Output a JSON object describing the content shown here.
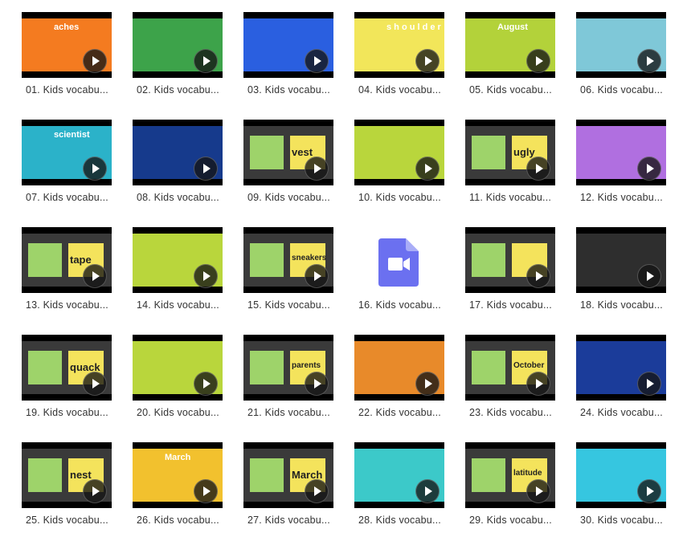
{
  "items": [
    {
      "label": "01. Kids vocabu...",
      "bg": "#F47B20",
      "word": "aches"
    },
    {
      "label": "02. Kids vocabu...",
      "bg": "#3DA34A",
      "word": ""
    },
    {
      "label": "03. Kids vocabu...",
      "bg": "#2A5FE0",
      "word": ""
    },
    {
      "label": "04. Kids vocabu...",
      "bg": "#F2E65A",
      "word": "s h o u l d e r"
    },
    {
      "label": "05. Kids vocabu...",
      "bg": "#B3D23A",
      "word": "August"
    },
    {
      "label": "06. Kids vocabu...",
      "bg": "#7FC8D8",
      "word": ""
    },
    {
      "label": "07. Kids vocabu...",
      "bg": "#2BB2C9",
      "word": "scientist"
    },
    {
      "label": "08. Kids vocabu...",
      "bg": "#163A8C",
      "word": ""
    },
    {
      "label": "09. Kids vocabu...",
      "bg": "#3A3A3A",
      "word": "vest"
    },
    {
      "label": "10. Kids vocabu...",
      "bg": "#B9D63C",
      "word": ""
    },
    {
      "label": "11. Kids vocabu...",
      "bg": "#3A3A3A",
      "word": "ugly"
    },
    {
      "label": "12. Kids vocabu...",
      "bg": "#B06FE0",
      "word": ""
    },
    {
      "label": "13. Kids vocabu...",
      "bg": "#3A3A3A",
      "word": "tape"
    },
    {
      "label": "14. Kids vocabu...",
      "bg": "#B9D63C",
      "word": ""
    },
    {
      "label": "15. Kids vocabu...",
      "bg": "#3A3A3A",
      "word": "sneakers"
    },
    {
      "label": "16. Kids vocabu...",
      "bg": "",
      "word": ""
    },
    {
      "label": "17. Kids vocabu...",
      "bg": "#3A3A3A",
      "word": ""
    },
    {
      "label": "18. Kids vocabu...",
      "bg": "#2E2E2E",
      "word": ""
    },
    {
      "label": "19. Kids vocabu...",
      "bg": "#3A3A3A",
      "word": "quack"
    },
    {
      "label": "20. Kids vocabu...",
      "bg": "#B9D63C",
      "word": ""
    },
    {
      "label": "21. Kids vocabu...",
      "bg": "#3A3A3A",
      "word": "parents"
    },
    {
      "label": "22. Kids vocabu...",
      "bg": "#E88A2A",
      "word": ""
    },
    {
      "label": "23. Kids vocabu...",
      "bg": "#3A3A3A",
      "word": "October"
    },
    {
      "label": "24. Kids vocabu...",
      "bg": "#1B3C9A",
      "word": ""
    },
    {
      "label": "25. Kids vocabu...",
      "bg": "#3A3A3A",
      "word": "nest"
    },
    {
      "label": "26. Kids vocabu...",
      "bg": "#F2C12E",
      "word": "March"
    },
    {
      "label": "27. Kids vocabu...",
      "bg": "#3A3A3A",
      "word": "March"
    },
    {
      "label": "28. Kids vocabu...",
      "bg": "#3CC9C9",
      "word": ""
    },
    {
      "label": "29. Kids vocabu...",
      "bg": "#3A3A3A",
      "word": "latitude"
    },
    {
      "label": "30. Kids vocabu...",
      "bg": "#36C6E0",
      "word": ""
    }
  ],
  "file_icon": {
    "color": "#6B70F0",
    "fold_color": "#A9ADF7"
  }
}
